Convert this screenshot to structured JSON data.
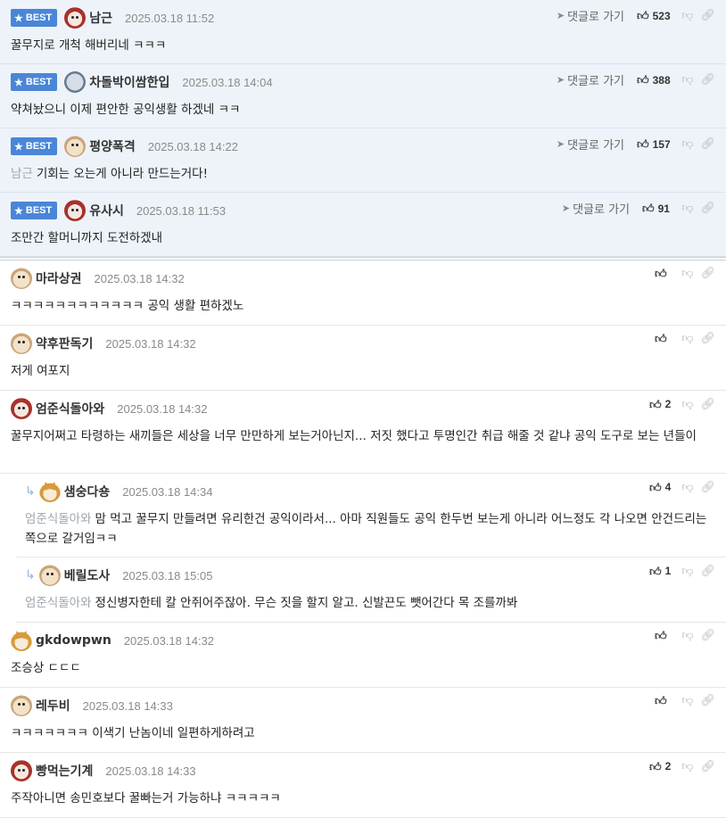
{
  "best_label": "BEST",
  "goto_label": "댓글로 가기",
  "comments": [
    {
      "nick": "남근",
      "date": "2025.03.18 11:52",
      "text": "꿀무지로 개척 해버리네 ㅋㅋㅋ",
      "likes": "523"
    },
    {
      "nick": "차돌박이쌈한입",
      "date": "2025.03.18 14:04",
      "text": "약쳐놨으니 이제 편안한 공익생활 하겠네 ㅋㅋ",
      "likes": "388"
    },
    {
      "nick": "평양폭격",
      "date": "2025.03.18 14:22",
      "mention": "남근",
      "text": "기회는 오는게 아니라 만드는거다!",
      "likes": "157"
    },
    {
      "nick": "유사시",
      "date": "2025.03.18 11:53",
      "text": "조만간 할머니까지 도전하겠내",
      "likes": "91"
    },
    {
      "nick": "마라상권",
      "date": "2025.03.18 14:32",
      "text": "ㅋㅋㅋㅋㅋㅋㅋㅋㅋㅋㅋㅋ 공익 생활 편하겠노",
      "likes": ""
    },
    {
      "nick": "약후판독기",
      "date": "2025.03.18 14:32",
      "text": "저게 여포지",
      "likes": ""
    },
    {
      "nick": "엄준식돌아와",
      "date": "2025.03.18 14:32",
      "text": "꿀무지어쩌고 타령하는 새끼들은 세상을 너무 만만하게 보는거아닌지... 저짓 했다고 투명인간 취급 해줄 것 같냐 공익 도구로 보는 년들이",
      "likes": "2"
    },
    {
      "nick": "샘숭다숑",
      "date": "2025.03.18 14:34",
      "mention": "엄준식돌아와",
      "text": "맘 먹고 꿀무지 만들려면 유리한건 공익이라서... 아마 직원들도 공익 한두번 보는게 아니라 어느정도 각 나오면 안건드리는쪽으로 갈거임ㅋㅋ",
      "likes": "4"
    },
    {
      "nick": "베릴도사",
      "date": "2025.03.18 15:05",
      "mention": "엄준식돌아와",
      "text": "정신병자한테 칼 안쥐어주잖아. 무슨 짓을 할지 알고. 신발끈도 뺏어간다 목 조를까봐",
      "likes": "1"
    },
    {
      "nick": "gkdowpwn",
      "date": "2025.03.18 14:32",
      "text": "조승상 ㄷㄷㄷ",
      "likes": ""
    },
    {
      "nick": "레두비",
      "date": "2025.03.18 14:33",
      "text": "ㅋㅋㅋㅋㅋㅋㅋ 이색기 난놈이네 일편하게하려고",
      "likes": ""
    },
    {
      "nick": "빵먹는기계",
      "date": "2025.03.18 14:33",
      "text": "주작아니면 송민호보다 꿀빠는거 가능하냐 ㅋㅋㅋㅋㅋ",
      "likes": "2"
    }
  ],
  "colors": {
    "best_bg": "#eef3fa",
    "badge": "#4a86d8",
    "mention": "#9ea5ad"
  }
}
